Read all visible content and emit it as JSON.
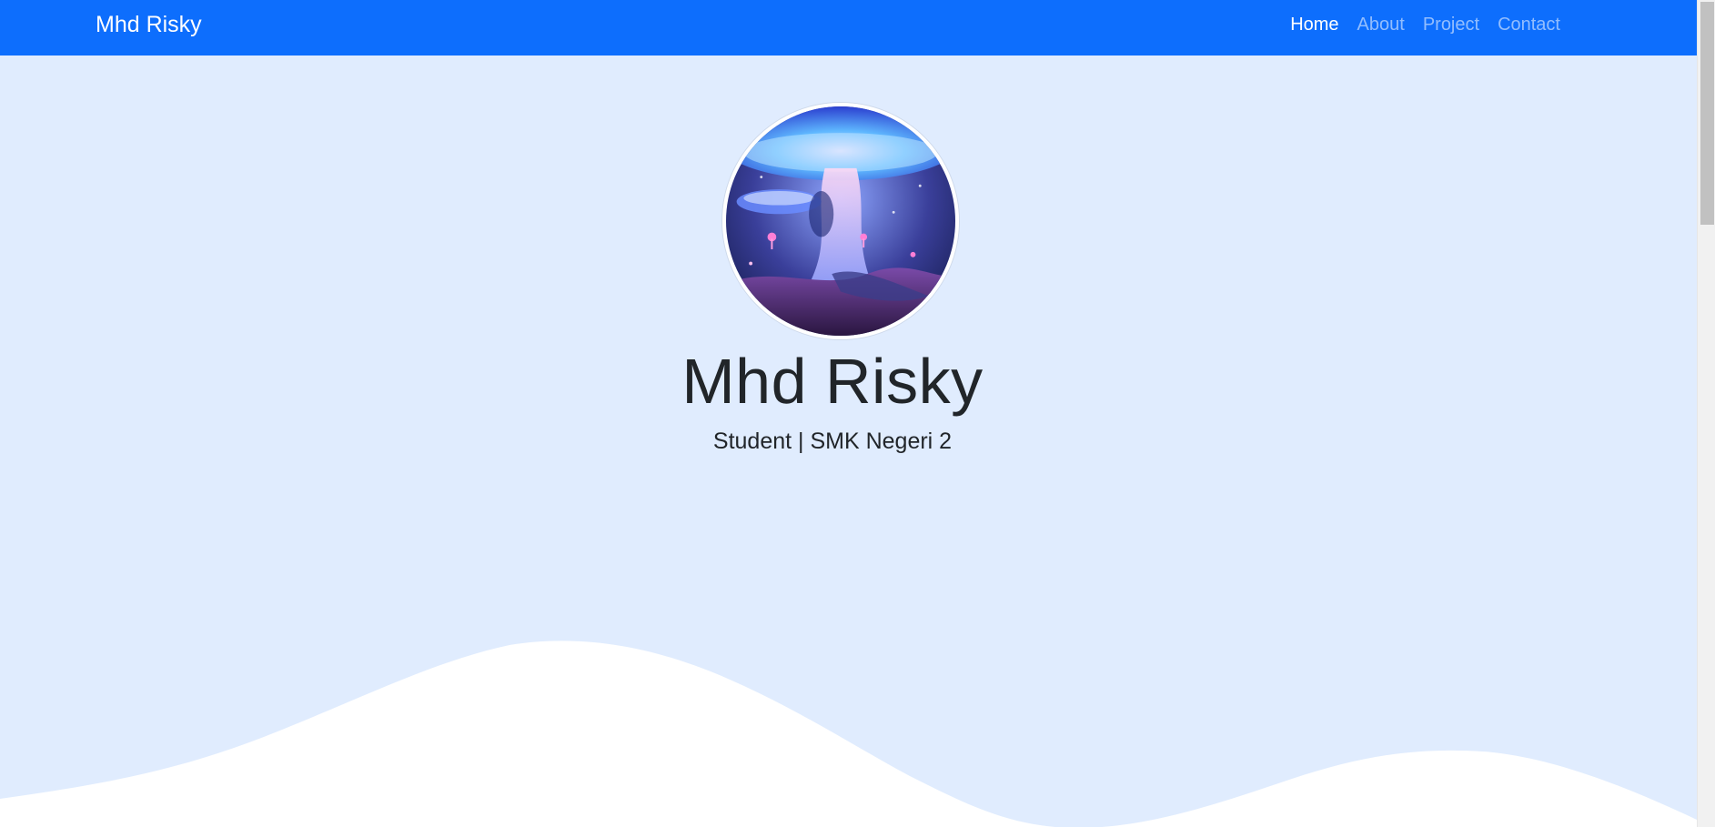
{
  "navbar": {
    "brand": "Mhd Risky",
    "items": [
      {
        "label": "Home",
        "active": true
      },
      {
        "label": "About",
        "active": false
      },
      {
        "label": "Project",
        "active": false
      },
      {
        "label": "Contact",
        "active": false
      }
    ]
  },
  "hero": {
    "name": "Mhd Risky",
    "subtitle": "Student | SMK Negeri 2"
  },
  "colors": {
    "navbar": "#0d6efd",
    "hero_bg": "#e0ecfe",
    "wave": "#ffffff"
  }
}
